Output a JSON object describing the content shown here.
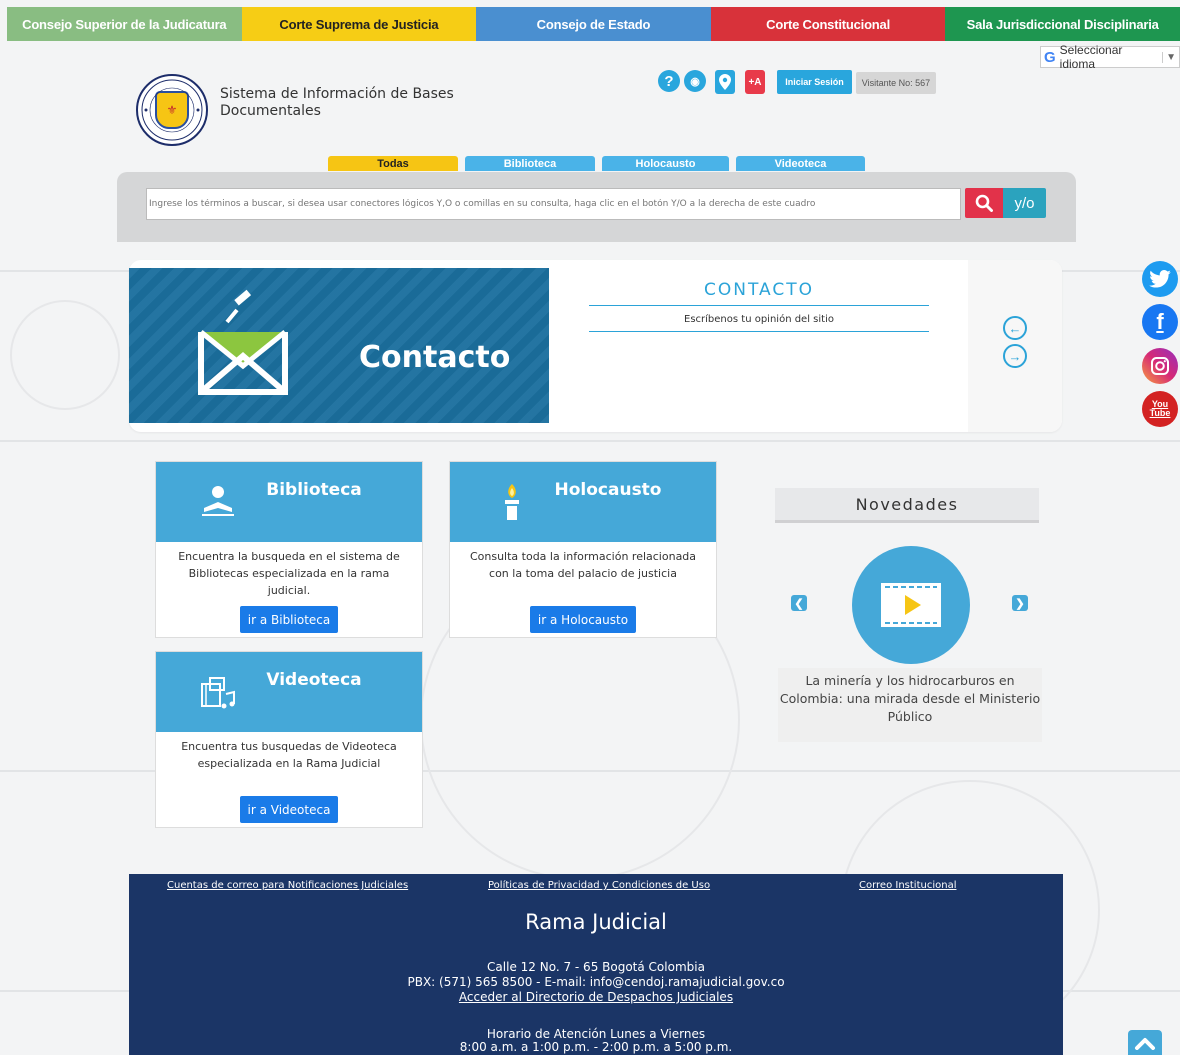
{
  "topbar": {
    "items": [
      "Consejo Superior de la Judicatura",
      "Corte Suprema de Justicia",
      "Consejo de Estado",
      "Corte Constitucional",
      "Sala Jurisdiccional Disciplinaria"
    ]
  },
  "language": {
    "label": "Seleccionar idioma",
    "arrow": "▼"
  },
  "site": {
    "title_line1": "Sistema de Información de Bases",
    "title_line2": "Documentales"
  },
  "utility": {
    "help": "?",
    "audio": "◉",
    "font_increase": "+A",
    "login": "Iniciar Sesión",
    "visits": "Visitante No: 567"
  },
  "search_tabs": [
    "Todas",
    "Biblioteca",
    "Holocausto",
    "Videoteca"
  ],
  "search": {
    "placeholder": "Ingrese los términos a buscar, si desea usar conectores lógicos Y,O o comillas en su consulta, haga clic en el botón Y/O a la derecha de este cuadro",
    "logic_button": "y/o"
  },
  "slide": {
    "banner_text": "Contacto",
    "heading": "CONTACTO",
    "text": "Escríbenos tu opinión del sitio",
    "prev": "←",
    "next": "→"
  },
  "cards": [
    {
      "title": "Biblioteca",
      "desc": "Encuentra la busqueda en el sistema de Bibliotecas especializada en la rama judicial.",
      "button": "ir a Biblioteca"
    },
    {
      "title": "Holocausto",
      "desc": "Consulta toda la información relacionada con la toma del palacio de justicia",
      "button": "ir a Holocausto"
    },
    {
      "title": "Videoteca",
      "desc": "Encuentra tus busquedas de Videoteca especializada en la Rama Judicial",
      "button": "ir a Videoteca"
    }
  ],
  "novedades": {
    "title": "Novedades",
    "item_text": "La minería y los hidrocarburos en Colombia: una mirada desde el Ministerio Público",
    "prev": "❮",
    "next": "❯"
  },
  "social": {
    "facebook": "f",
    "youtube_line1": "You",
    "youtube_line2": "Tube"
  },
  "footer": {
    "links": [
      "Cuentas de correo para Notificaciones Judiciales",
      "Políticas de Privacidad y Condiciones de Uso",
      "Correo Institucional"
    ],
    "title": "Rama Judicial",
    "address": "Calle 12 No. 7 - 65 Bogotá Colombia",
    "contact": "PBX: (571) 565 8500 - E-mail: info@cendoj.ramajudicial.gov.co",
    "directory_link": "Acceder al Directorio de Despachos Judiciales",
    "hours_title": "Horario de Atención Lunes a Viernes",
    "hours": "8:00 a.m. a 1:00 p.m. - 2:00 p.m. a 5:00 p.m."
  },
  "colors": {
    "topbar": [
      "#89bd82",
      "#f6cd15",
      "#4a8fd0",
      "#d8323a",
      "#1e9650"
    ],
    "accent_blue": "#45a8d8",
    "button_blue": "#1a7be8",
    "footer_bg": "#1b3566",
    "search_red": "#e2324a"
  }
}
